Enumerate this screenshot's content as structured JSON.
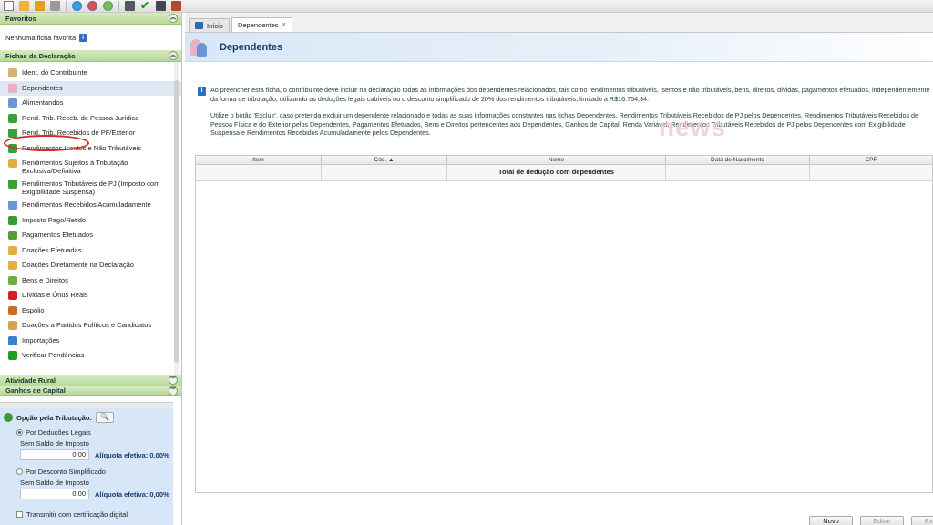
{
  "toolbar": {
    "icons": [
      "new-doc-icon",
      "open-folder-icon",
      "save-icon",
      "trash-icon",
      "globe-icon",
      "globe-red-icon",
      "earth-icon",
      "printer-icon",
      "check-icon",
      "calculator-icon",
      "book-icon"
    ]
  },
  "sidebar": {
    "favoritos": {
      "title": "Favoritos",
      "empty_text": "Nenhuma ficha favorita"
    },
    "fichas": {
      "title": "Fichas da Declaração",
      "items": [
        {
          "label": "Ident. do Contribuinte",
          "icon": "person-icon",
          "color": "#d9b27a"
        },
        {
          "label": "Dependentes",
          "icon": "dependents-icon",
          "color": "#e6b3c4"
        },
        {
          "label": "Alimentandos",
          "icon": "people-icon",
          "color": "#6b95d6"
        },
        {
          "label": "Rend. Trib. Receb. de Pessoa Jurídica",
          "icon": "money-building-icon",
          "color": "#3aa03a"
        },
        {
          "label": "Rend. Trib. Recebidos de PF/Exterior",
          "icon": "money-globe-icon",
          "color": "#3aa03a"
        },
        {
          "label": "Rendimentos Isentos e Não Tributáveis",
          "icon": "money-shield-icon",
          "color": "#3aa03a"
        },
        {
          "label": "Rendimentos Sujeitos à Tributação Exclusiva/Definitiva",
          "icon": "money-doc-icon",
          "color": "#e0b040"
        },
        {
          "label": "Rendimentos Tributáveis de PJ (Imposto com Exigibilidade Suspensa)",
          "icon": "money-hold-icon",
          "color": "#3aa03a"
        },
        {
          "label": "Rendimentos Recebidos Acumuladamente",
          "icon": "money-stack-icon",
          "color": "#6b95d6"
        },
        {
          "label": "Imposto Pago/Retido",
          "icon": "coin-icon",
          "color": "#3a9a3a"
        },
        {
          "label": "Pagamentos Efetuados",
          "icon": "card-icon",
          "color": "#5a9a3a"
        },
        {
          "label": "Doações Efetuadas",
          "icon": "gift-icon",
          "color": "#e0b040"
        },
        {
          "label": "Doações Diretamente na Declaração",
          "icon": "donation-doc-icon",
          "color": "#e0b040"
        },
        {
          "label": "Bens e Direitos",
          "icon": "house-money-icon",
          "color": "#6ab040"
        },
        {
          "label": "Dívidas e Ônus Reais",
          "icon": "arrow-down-icon",
          "color": "#d02020"
        },
        {
          "label": "Espólio",
          "icon": "chest-icon",
          "color": "#c07030"
        },
        {
          "label": "Doações a Partidos Políticos e Candidatos",
          "icon": "vote-icon",
          "color": "#d9a050"
        },
        {
          "label": "Importações",
          "icon": "import-globe-icon",
          "color": "#3a80c8"
        },
        {
          "label": "Verificar Pendências",
          "icon": "check-icon",
          "color": "#1aa01a"
        }
      ]
    },
    "atividade_rural": {
      "title": "Atividade Rural"
    },
    "ganhos_capital": {
      "title": "Ganhos de Capital"
    },
    "tributacao": {
      "label": "Opção pela Tributação:",
      "deducoes": {
        "label": "Por Deduções Legais",
        "saldo": "Sem Saldo de Imposto",
        "value": "0,00",
        "aliquota": "Alíquota efetiva: 0,00%"
      },
      "simplificado": {
        "label": "Por Desconto Simplificado",
        "saldo": "Sem Saldo de Imposto",
        "value": "0,00",
        "aliquota": "Alíquota efetiva: 0,00%"
      },
      "transmitir": "Transmitir com certificação digital"
    }
  },
  "tabs": [
    {
      "label": "Início"
    },
    {
      "label": "Dependentes",
      "close": "×"
    }
  ],
  "page": {
    "title": "Dependentes",
    "info_p1": "Ao preencher esta ficha, o contribuinte deve incluir na declaração todas as informações dos dependentes relacionados, tais como rendimentos tributáveis, isentos e não tributáveis, bens, direitos, dívidas, pagamentos efetuados, independentemente da forma de tributação, utilizando as deduções legais cabíveis ou o desconto simplificado de 20% dos rendimentos tributáveis, limitado a R$16.754,34.",
    "info_p2": "Utilize o botão 'Excluir', caso pretenda excluir um dependente relacionado e todas as suas informações constantes nas fichas Dependentes, Rendimentos Tributáveis Recebidos de PJ pelos Dependentes, Rendimentos Tributáveis Recebidos de Pessoa Física e do Exterior pelos Dependentes, Pagamentos Efetuados, Bens e Direitos pertencentes aos Dependentes, Ganhos de Capital, Renda Variável, Rendimentos Tributáveis Recebidos de PJ pelos Dependentes com Exigibilidade Suspensa e Rendimentos Recebidos Acumuladamente pelos Dependentes.",
    "watermark": "news"
  },
  "table": {
    "columns": [
      "Item",
      "Cód. ▲",
      "Nome",
      "Data de Nascimento",
      "CPF"
    ],
    "total_label": "Total de dedução com dependentes"
  },
  "buttons": {
    "novo": "Novo",
    "editar": "Editar",
    "excluir": "Exclu"
  },
  "colors": {
    "accent_green": "#b8d99a",
    "banner_blue": "#d7e8f7",
    "selection": "#dde8f4",
    "mark_red": "#d62828"
  }
}
